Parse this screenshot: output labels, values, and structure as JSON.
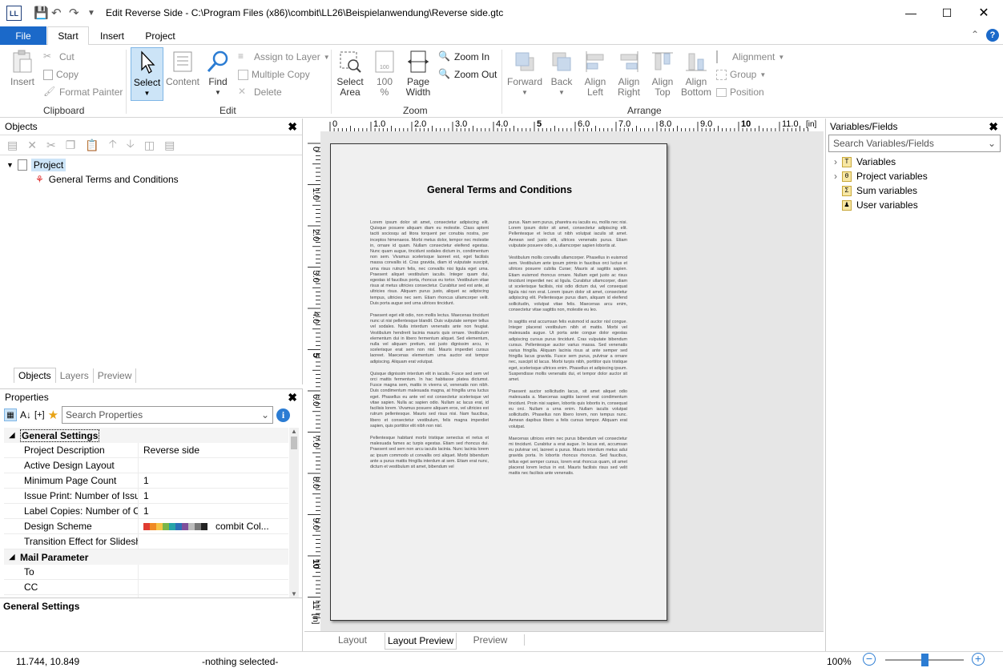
{
  "title": {
    "app_icon": "LL",
    "text": "Edit Reverse Side - C:\\Program Files (x86)\\combit\\LL26\\Beispielanwendung\\Reverse side.gtc"
  },
  "menu": {
    "file": "File",
    "tabs": [
      "Start",
      "Insert",
      "Project"
    ]
  },
  "ribbon": {
    "clipboard": {
      "insert": "Insert",
      "cut": "Cut",
      "copy": "Copy",
      "format_painter": "Format Painter",
      "group": "Clipboard"
    },
    "edit": {
      "select": "Select",
      "content": "Content",
      "find": "Find",
      "assign_to_layer": "Assign to Layer",
      "multiple_copy": "Multiple Copy",
      "delete": "Delete",
      "group": "Edit"
    },
    "zoom": {
      "select_area": [
        "Select",
        "Area"
      ],
      "percent": [
        "100",
        "%"
      ],
      "page_width": [
        "Page",
        "Width"
      ],
      "zoom_in": "Zoom In",
      "zoom_out": "Zoom Out",
      "group": "Zoom"
    },
    "arrange": {
      "forward": "Forward",
      "back": "Back",
      "align_left": [
        "Align",
        "Left"
      ],
      "align_right": [
        "Align",
        "Right"
      ],
      "align_top": [
        "Align",
        "Top"
      ],
      "align_bottom": [
        "Align",
        "Bottom"
      ],
      "alignment": "Alignment",
      "group_btn": "Group",
      "position": "Position",
      "group": "Arrange"
    }
  },
  "objects": {
    "title": "Objects",
    "project": "Project",
    "child": "General Terms and Conditions",
    "tabs": [
      "Objects",
      "Layers",
      "Preview"
    ]
  },
  "properties": {
    "title": "Properties",
    "search_placeholder": "Search Properties",
    "cat1": "General Settings",
    "rows": [
      {
        "k": "Project Description",
        "v": "Reverse side"
      },
      {
        "k": "Active Design Layout",
        "v": ""
      },
      {
        "k": "Minimum Page Count",
        "v": "1"
      },
      {
        "k": "Issue Print: Number of Issues",
        "v": "1"
      },
      {
        "k": "Label Copies: Number of Co...",
        "v": "1"
      },
      {
        "k": "Design Scheme",
        "v": "combit Col..."
      },
      {
        "k": "Transition Effect for Slidesho...",
        "v": ""
      }
    ],
    "cat2": "Mail Parameter",
    "rows2": [
      {
        "k": "To",
        "v": ""
      },
      {
        "k": "CC",
        "v": ""
      },
      {
        "k": "BCC",
        "v": ""
      }
    ],
    "footer": "General Settings",
    "scheme_colors": [
      "#e03c31",
      "#f08a24",
      "#f6c445",
      "#7ab648",
      "#27a4a8",
      "#2d6fb7",
      "#7f4f9b",
      "#bbbbbb",
      "#777777",
      "#222222"
    ]
  },
  "ruler": {
    "h": [
      "0",
      "1.0",
      "2.0",
      "3.0",
      "4.0",
      "5",
      "6.0",
      "7.0",
      "8.0",
      "9.0",
      "10",
      "11.0"
    ],
    "v": [
      "0",
      "1.0",
      "2.0",
      "3.0",
      "4.0",
      "5",
      "6.0",
      "7.0",
      "8.0",
      "9.0",
      "10",
      "11"
    ],
    "unit": "[in]"
  },
  "document": {
    "heading": "General Terms and Conditions",
    "left": [
      "Lorem ipsum dolor sit amet, consectetur adipiscing elit. Quisque posuere aliquam diam eu molestie. Class aptent taciti sociosqu ad litora torquent per conubia nostra, per inceptos himenaeos. Morbi metus dolor, tempor nec molestie in, ornare id quam. Nullam consectetur eleifend egestas. Nunc quam augue, tincidunt sodales dictum in, condimentum non sem. Vivamus scelerisque laoreet est, eget facilisis massa convallis id. Cras gravida, diam id vulputate suscipit, urna risus rutrum felis, nec convallis nisi ligula eget urna. Praesent aliquet vestibulum iaculis. Integer quam dui, egestas id faucibus porta, rhoncus eu tortor. Vestibulum vitae risus at metus ultricies consectetur. Curabitur sed est ante, at ultricies risus. Aliquam purus justo, aliquet ac adipiscing tempus, ultricies nec sem. Etiam rhoncus ullamcorper velit. Duis porta augue sed urna ultrices tincidunt.",
      "Praesent eget elit odio, non mollis lectus. Maecenas tincidunt nunc ut nisi pellentesque blandit. Duis vulputate semper tellus vel sodales. Nulla interdum venenatis ante non feugiat. Vestibulum hendrerit lacinia mauris quis ornare. Vestibulum elementum dui in libero fermentum aliquet. Sed elementum, nulla vel aliquam pretium, est justo dignissim arcu, in scelerisque erat sem non nisl. Mauris imperdiet cursus laoreet. Maecenas elementum urna auctor est tempor adipiscing. Aliquam erat volutpat.",
      "Quisque dignissim interdum elit in iaculis. Fusce sed sem vel orci mattis fermentum. In hac habitasse platea dictumst. Fusce magna sem, mattis in viverra ut, venenatis non nibh. Duis condimentum malesuada magna, at fringilla urna luctus eget. Phasellus eu ante vel est consectetur scelerisque vel vitae sapien. Nulla ac sapien odio. Nullam ac lacus erat, id facilisis lorem. Vivamus posuere aliquam eros, vel ultricies est rutrum pellentesque. Mauris sed risus nisi. Nam faucibus, libero et consectetur vestibulum, felis magna imperdiet sapien, quis porttitor elit nibh non nisl.",
      "Pellentesque habitant morbi tristique senectus et netus et malesuada fames ac turpis egestas. Etiam sed rhoncus dui. Praesent sed sem non arcu iaculis lacinia. Nunc lacinia lorem ac ipsum commodo ut convallis orci aliquet. Morbi bibendum ante a purus mattis fringilla interdum at sem. Etiam erat nunc, dictum et vestibulum sit amet, bibendum vel"
    ],
    "right": [
      "purus. Nam sem purus, pharetra eu iaculis eu, mollis nec nisi. Lorem ipsum dolor sit amet, consectetur adipiscing elit. Pellentesque et lectus ut nibh volutpat iaculis sit amet. Aenean sed justo elit, ultrices venenatis purus. Etiam vulputate posuere odio, a ullamcorper sapien lobortis at.",
      "Vestibulum mollis convallis ullamcorper. Phasellus in euismod sem. Vestibulum ante ipsum primis in faucibus orci luctus et ultrices posuere cubilia Curae; Mauris at sagittis sapien. Etiam euismod rhoncus ornare. Nullam eget justo ac risus tincidunt imperdiet nec at ligula. Curabitur ullamcorper, diam ut scelerisque facilisis, nisi odio dictum dui, vel consequat ligula nisi non erat. Lorem ipsum dolor sit amet, consectetur adipiscing elit. Pellentesque purus diam, aliquam id eleifend sollicitudin, volutpat vitae felis. Maecenas arcu enim, consectetur vitae sagittis non, molestie eu leo.",
      "In sagittis erat accumsan felis euismod id auctor nisl congue. Integer placerat vestibulum nibh et mattis. Morbi vel malesuada augue. Ut porta ante congue dolor egestas adipiscing cursus purus tincidunt. Cras vulputate bibendum cursus. Pellentesque auctor varius massa. Sed venenatis varius fringilla. Aliquam lacinia risus at ante semper sed fringilla lacus gravida. Fusce sem purus, pulvinar a ornare nec, suscipit id lacus. Morbi turpis nibh, porttitor quis tristique eget, scelerisque ultrices enim. Phasellus et adipiscing ipsum. Suspendisse mollis venenatis dui, et tempor dolor auctor sit amet.",
      "Praesent auctor sollicitudin lacus, sit amet aliquet odio malesuada a. Maecenas sagittis laoreet erat condimentum tincidunt. Proin nisi sapien, lobortis quis lobortis in, consequat eu orci. Nullam a urna enim. Nullam iaculis volutpat sollicitudin. Phasellus non libero lorem, non tempus nunc. Aenean dapibus libero a felis cursus tempor. Aliquam erat volutpat.",
      "Maecenas ultrices enim nec purus bibendum vel consectetur mi tincidunt. Curabitur a erat augue. In lacus est, accumsan eu pulvinar vel, laoreet a purus. Mauris interdum metus adui gravida porta. In lobortis rhoncus rhoncus. Sed faucibus, tellus eget semper cursus, lorem erat rhoncus quam, sit amet placerat lorem lectus in est. Mauris facilisis risus sed velit mattis nec facilisis ante venenatis."
    ]
  },
  "designer_tabs": [
    "Layout",
    "Layout Preview",
    "Preview"
  ],
  "varfields": {
    "title": "Variables/Fields",
    "search_placeholder": "Search Variables/Fields",
    "items": [
      "Variables",
      "Project variables",
      "Sum variables",
      "User variables"
    ]
  },
  "status": {
    "coords": "11.744, 10.849",
    "selection": "-nothing selected-",
    "zoom": "100%",
    "zoom_level": 0.5
  },
  "colors": {
    "accent": "#1b69c9",
    "selected": "#cce4f7"
  }
}
